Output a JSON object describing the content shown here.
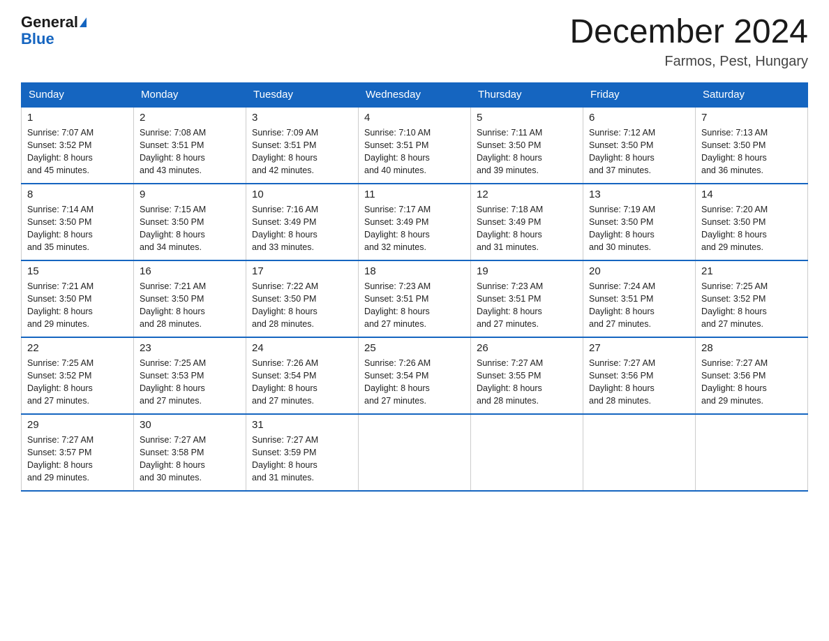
{
  "header": {
    "logo_general": "General",
    "logo_blue": "Blue",
    "month_title": "December 2024",
    "location": "Farmos, Pest, Hungary"
  },
  "days_of_week": [
    "Sunday",
    "Monday",
    "Tuesday",
    "Wednesday",
    "Thursday",
    "Friday",
    "Saturday"
  ],
  "weeks": [
    [
      {
        "day": "1",
        "sunrise": "7:07 AM",
        "sunset": "3:52 PM",
        "daylight": "8 hours and 45 minutes."
      },
      {
        "day": "2",
        "sunrise": "7:08 AM",
        "sunset": "3:51 PM",
        "daylight": "8 hours and 43 minutes."
      },
      {
        "day": "3",
        "sunrise": "7:09 AM",
        "sunset": "3:51 PM",
        "daylight": "8 hours and 42 minutes."
      },
      {
        "day": "4",
        "sunrise": "7:10 AM",
        "sunset": "3:51 PM",
        "daylight": "8 hours and 40 minutes."
      },
      {
        "day": "5",
        "sunrise": "7:11 AM",
        "sunset": "3:50 PM",
        "daylight": "8 hours and 39 minutes."
      },
      {
        "day": "6",
        "sunrise": "7:12 AM",
        "sunset": "3:50 PM",
        "daylight": "8 hours and 37 minutes."
      },
      {
        "day": "7",
        "sunrise": "7:13 AM",
        "sunset": "3:50 PM",
        "daylight": "8 hours and 36 minutes."
      }
    ],
    [
      {
        "day": "8",
        "sunrise": "7:14 AM",
        "sunset": "3:50 PM",
        "daylight": "8 hours and 35 minutes."
      },
      {
        "day": "9",
        "sunrise": "7:15 AM",
        "sunset": "3:50 PM",
        "daylight": "8 hours and 34 minutes."
      },
      {
        "day": "10",
        "sunrise": "7:16 AM",
        "sunset": "3:49 PM",
        "daylight": "8 hours and 33 minutes."
      },
      {
        "day": "11",
        "sunrise": "7:17 AM",
        "sunset": "3:49 PM",
        "daylight": "8 hours and 32 minutes."
      },
      {
        "day": "12",
        "sunrise": "7:18 AM",
        "sunset": "3:49 PM",
        "daylight": "8 hours and 31 minutes."
      },
      {
        "day": "13",
        "sunrise": "7:19 AM",
        "sunset": "3:50 PM",
        "daylight": "8 hours and 30 minutes."
      },
      {
        "day": "14",
        "sunrise": "7:20 AM",
        "sunset": "3:50 PM",
        "daylight": "8 hours and 29 minutes."
      }
    ],
    [
      {
        "day": "15",
        "sunrise": "7:21 AM",
        "sunset": "3:50 PM",
        "daylight": "8 hours and 29 minutes."
      },
      {
        "day": "16",
        "sunrise": "7:21 AM",
        "sunset": "3:50 PM",
        "daylight": "8 hours and 28 minutes."
      },
      {
        "day": "17",
        "sunrise": "7:22 AM",
        "sunset": "3:50 PM",
        "daylight": "8 hours and 28 minutes."
      },
      {
        "day": "18",
        "sunrise": "7:23 AM",
        "sunset": "3:51 PM",
        "daylight": "8 hours and 27 minutes."
      },
      {
        "day": "19",
        "sunrise": "7:23 AM",
        "sunset": "3:51 PM",
        "daylight": "8 hours and 27 minutes."
      },
      {
        "day": "20",
        "sunrise": "7:24 AM",
        "sunset": "3:51 PM",
        "daylight": "8 hours and 27 minutes."
      },
      {
        "day": "21",
        "sunrise": "7:25 AM",
        "sunset": "3:52 PM",
        "daylight": "8 hours and 27 minutes."
      }
    ],
    [
      {
        "day": "22",
        "sunrise": "7:25 AM",
        "sunset": "3:52 PM",
        "daylight": "8 hours and 27 minutes."
      },
      {
        "day": "23",
        "sunrise": "7:25 AM",
        "sunset": "3:53 PM",
        "daylight": "8 hours and 27 minutes."
      },
      {
        "day": "24",
        "sunrise": "7:26 AM",
        "sunset": "3:54 PM",
        "daylight": "8 hours and 27 minutes."
      },
      {
        "day": "25",
        "sunrise": "7:26 AM",
        "sunset": "3:54 PM",
        "daylight": "8 hours and 27 minutes."
      },
      {
        "day": "26",
        "sunrise": "7:27 AM",
        "sunset": "3:55 PM",
        "daylight": "8 hours and 28 minutes."
      },
      {
        "day": "27",
        "sunrise": "7:27 AM",
        "sunset": "3:56 PM",
        "daylight": "8 hours and 28 minutes."
      },
      {
        "day": "28",
        "sunrise": "7:27 AM",
        "sunset": "3:56 PM",
        "daylight": "8 hours and 29 minutes."
      }
    ],
    [
      {
        "day": "29",
        "sunrise": "7:27 AM",
        "sunset": "3:57 PM",
        "daylight": "8 hours and 29 minutes."
      },
      {
        "day": "30",
        "sunrise": "7:27 AM",
        "sunset": "3:58 PM",
        "daylight": "8 hours and 30 minutes."
      },
      {
        "day": "31",
        "sunrise": "7:27 AM",
        "sunset": "3:59 PM",
        "daylight": "8 hours and 31 minutes."
      },
      null,
      null,
      null,
      null
    ]
  ],
  "labels": {
    "sunrise": "Sunrise:",
    "sunset": "Sunset:",
    "daylight": "Daylight:"
  }
}
